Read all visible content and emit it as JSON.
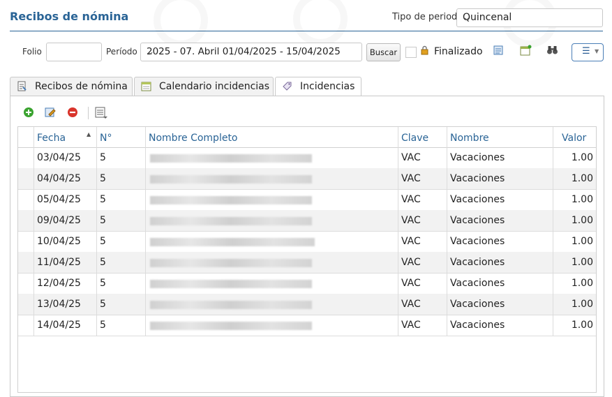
{
  "header": {
    "title": "Recibos de nómina",
    "tipo_periodo_label": "Tipo de periodo",
    "tipo_periodo_value": "Quincenal"
  },
  "toolbar": {
    "folio_label": "Folio",
    "folio_value": "",
    "periodo_label": "Período",
    "periodo_value": "2025 - 07. Abril 01/04/2025 - 15/04/2025",
    "buscar_label": "Buscar",
    "finalizado_label": "Finalizado",
    "finalizado_checked": false
  },
  "tabs": [
    {
      "label": "Recibos de nómina",
      "icon": "receipt-icon"
    },
    {
      "label": "Calendario incidencias",
      "icon": "calendar-icon"
    },
    {
      "label": "Incidencias",
      "icon": "tag-icon",
      "active": true
    }
  ],
  "grid": {
    "columns": [
      "Fecha",
      "N°",
      "Nombre Completo",
      "Clave",
      "Nombre",
      "Valor"
    ],
    "sorted_column": "Fecha",
    "sort_direction": "asc",
    "rows": [
      {
        "fecha": "03/04/25",
        "num": "5",
        "clave": "VAC",
        "nombre": "Vacaciones",
        "valor": "1.00"
      },
      {
        "fecha": "04/04/25",
        "num": "5",
        "clave": "VAC",
        "nombre": "Vacaciones",
        "valor": "1.00"
      },
      {
        "fecha": "05/04/25",
        "num": "5",
        "clave": "VAC",
        "nombre": "Vacaciones",
        "valor": "1.00"
      },
      {
        "fecha": "09/04/25",
        "num": "5",
        "clave": "VAC",
        "nombre": "Vacaciones",
        "valor": "1.00"
      },
      {
        "fecha": "10/04/25",
        "num": "5",
        "clave": "VAC",
        "nombre": "Vacaciones",
        "valor": "1.00"
      },
      {
        "fecha": "11/04/25",
        "num": "5",
        "clave": "VAC",
        "nombre": "Vacaciones",
        "valor": "1.00"
      },
      {
        "fecha": "12/04/25",
        "num": "5",
        "clave": "VAC",
        "nombre": "Vacaciones",
        "valor": "1.00"
      },
      {
        "fecha": "13/04/25",
        "num": "5",
        "clave": "VAC",
        "nombre": "Vacaciones",
        "valor": "1.00"
      },
      {
        "fecha": "14/04/25",
        "num": "5",
        "clave": "VAC",
        "nombre": "Vacaciones",
        "valor": "1.00"
      }
    ]
  },
  "colors": {
    "accent": "#2a6496",
    "row_alt": "#f2f2f2",
    "add_green": "#3aa32f",
    "delete_red": "#d9342b"
  }
}
